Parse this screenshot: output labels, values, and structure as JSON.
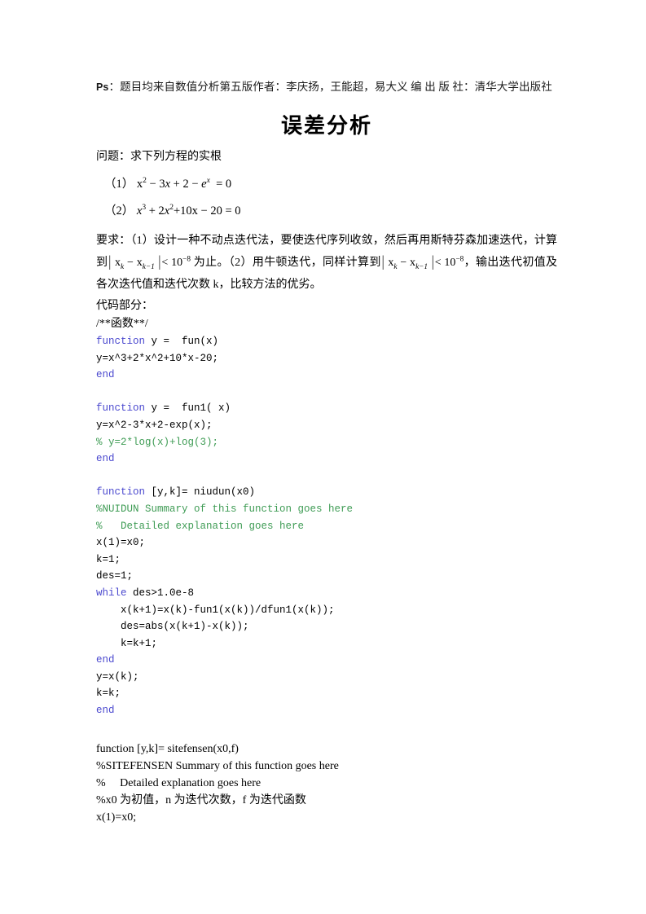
{
  "header": {
    "ps_label": "Ps",
    "ps_text": "：题目均来自数值分析第五版作者：李庆扬，王能超，易大义 编 出 版 社：清华大学出版社"
  },
  "title": "误差分析",
  "problem": {
    "intro": "问题：求下列方程的实根",
    "equations": [
      {
        "index": "（1）",
        "latex_like": "x² − 3x + 2 − e^x = 0"
      },
      {
        "index": "（2）",
        "latex_like": "x³ + 2x²+10x − 20 = 0"
      }
    ],
    "requirement": "要求：（1）设计一种不动点迭代法，要使迭代序列收敛，然后再用斯特芬森加速迭代，计算到｜xk − xk−1｜< 10⁻⁸ 为止。（2）用牛顿迭代，同样计算到｜xk − xk−1｜< 10⁻⁸，输出迭代初值及各次迭代值和迭代次数 k，比较方法的优劣。"
  },
  "code_section": {
    "heading": "代码部分：",
    "comment_banner": "/**函数**/",
    "blocks": [
      {
        "id": "fun",
        "lines": [
          [
            {
              "t": "function",
              "c": "kw"
            },
            {
              "t": " y = ",
              "c": "pl"
            },
            {
              "t": " fun(x)",
              "c": "pl"
            }
          ],
          [
            {
              "t": "y=x^3+2*x^2+10*x-20;",
              "c": "pl"
            }
          ],
          [
            {
              "t": "end",
              "c": "kw"
            }
          ]
        ]
      },
      {
        "id": "fun1",
        "lines": [
          [
            {
              "t": "function",
              "c": "kw"
            },
            {
              "t": " y = ",
              "c": "pl"
            },
            {
              "t": " fun1( x)",
              "c": "pl"
            }
          ],
          [
            {
              "t": "y=x^2-3*x+2-exp(x);",
              "c": "pl"
            }
          ],
          [
            {
              "t": "% y=2*log(x)+log(3);",
              "c": "cm"
            }
          ],
          [
            {
              "t": "end",
              "c": "kw"
            }
          ]
        ]
      },
      {
        "id": "niudun",
        "lines": [
          [
            {
              "t": "function",
              "c": "kw"
            },
            {
              "t": " [y,k]= niudun(x0)",
              "c": "pl"
            }
          ],
          [
            {
              "t": "%NUIDUN Summary of this function goes here",
              "c": "cm"
            }
          ],
          [
            {
              "t": "%   Detailed explanation goes here",
              "c": "cm"
            }
          ],
          [
            {
              "t": "x(1)=x0;",
              "c": "pl"
            }
          ],
          [
            {
              "t": "k=1;",
              "c": "pl"
            }
          ],
          [
            {
              "t": "des=1;",
              "c": "pl"
            }
          ],
          [
            {
              "t": "while",
              "c": "kw"
            },
            {
              "t": " des>1.0e-8",
              "c": "pl"
            }
          ],
          [
            {
              "t": "    x(k+1)=x(k)-fun1(x(k))/dfun1(x(k));",
              "c": "pl"
            }
          ],
          [
            {
              "t": "    des=abs(x(k+1)-x(k));",
              "c": "pl"
            }
          ],
          [
            {
              "t": "    k=k+1;",
              "c": "pl"
            }
          ],
          [
            {
              "t": "end",
              "c": "kw"
            }
          ],
          [
            {
              "t": "y=x(k);",
              "c": "pl"
            }
          ],
          [
            {
              "t": "k=k;",
              "c": "pl"
            }
          ],
          [
            {
              "t": "end",
              "c": "kw"
            }
          ]
        ]
      }
    ],
    "plain_tail": [
      "function [y,k]= sitefensen(x0,f)",
      "%SITEFENSEN Summary of this function goes here",
      "%     Detailed explanation goes here",
      "%x0 为初值，n 为迭代次数，f 为迭代函数",
      "x(1)=x0;"
    ]
  },
  "colors": {
    "keyword": "#4b49cf",
    "comment": "#3f9c55",
    "text": "#000000",
    "background": "#ffffff"
  }
}
